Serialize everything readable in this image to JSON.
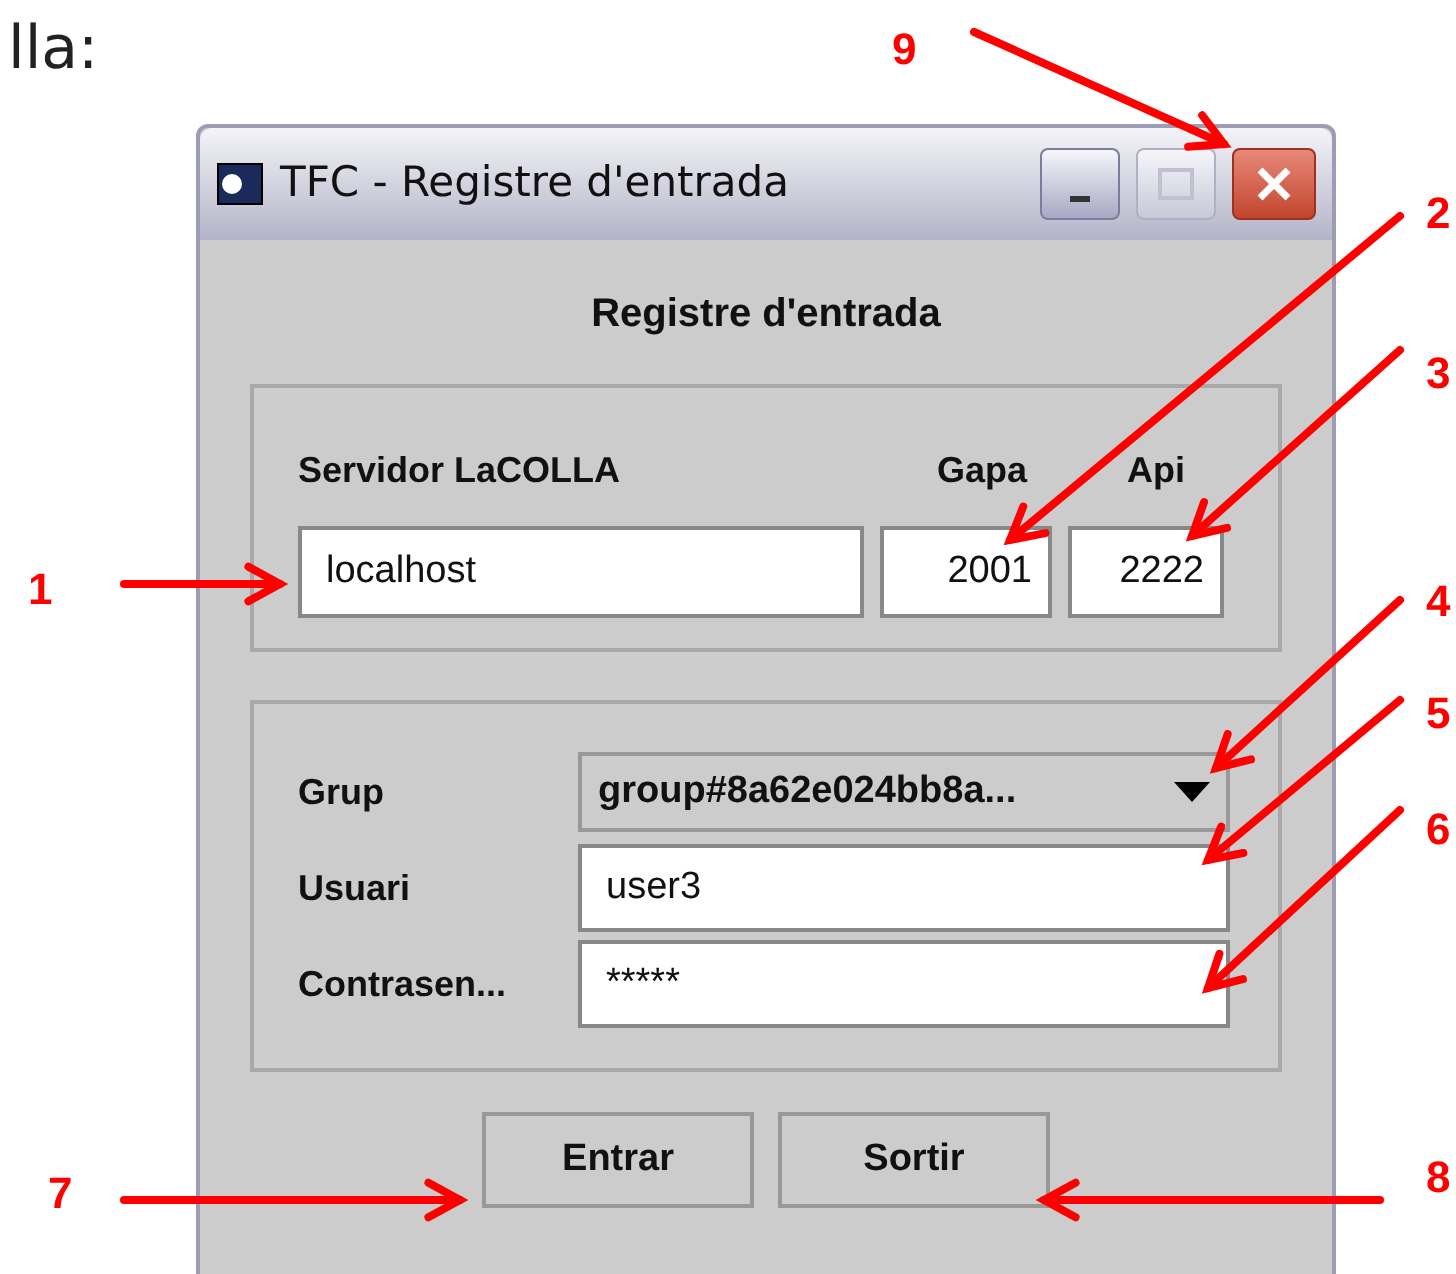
{
  "page_text": "lla:",
  "window": {
    "title": "TFC - Registre d'entrada",
    "heading": "Registre d'entrada",
    "server": {
      "labels": [
        "Servidor LaCOLLA",
        "Gapa",
        "Api"
      ],
      "values": [
        "localhost",
        "2001",
        "2222"
      ]
    },
    "login": {
      "rows": [
        {
          "kind": "combo",
          "label": "Grup",
          "value": "group#8a62e024bb8a..."
        },
        {
          "kind": "text",
          "label": "Usuari",
          "value": "user3"
        },
        {
          "kind": "text",
          "label": "Contrasen...",
          "value": "*****"
        }
      ]
    },
    "buttons": [
      "Entrar",
      "Sortir"
    ]
  },
  "annotations": [
    {
      "label": "9"
    },
    {
      "label": "2"
    },
    {
      "label": "3"
    },
    {
      "label": "1"
    },
    {
      "label": "4"
    },
    {
      "label": "5"
    },
    {
      "label": "6"
    },
    {
      "label": "7"
    },
    {
      "label": "8"
    }
  ]
}
